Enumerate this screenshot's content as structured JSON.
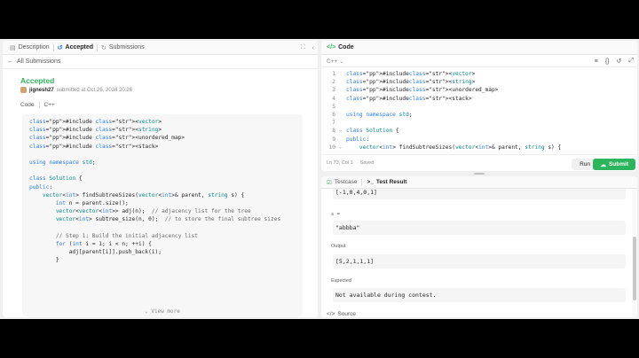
{
  "left_tabs": [
    {
      "label": "Description",
      "icon": "document-icon"
    },
    {
      "label": "Accepted",
      "icon": "history-icon"
    },
    {
      "label": "Submissions",
      "icon": "submissions-icon"
    }
  ],
  "back_link": "All Submissions",
  "submission": {
    "status": "Accepted",
    "user": "jignesh27",
    "submitted_text": "submitted at Oct 26, 2024 20:26",
    "code_tab": "Code",
    "lang": "C++"
  },
  "submission_code": [
    "#include <vector>",
    "#include <string>",
    "#include <unordered_map>",
    "#include <stack>",
    "",
    "using namespace std;",
    "",
    "class Solution {",
    "public:",
    "    vector<int> findSubtreeSizes(vector<int>& parent, string s) {",
    "        int n = parent.size();",
    "        vector<vector<int>> adj(n);  // adjacency list for the tree",
    "        vector<int> subtree_size(n, 0);  // to store the final subtree sizes",
    "",
    "        // Step 1: Build the initial adjacency list",
    "        for (int i = 1; i < n; ++i) {",
    "            adj[parent[i]].push_back(i);",
    "        }"
  ],
  "view_more": "View more",
  "code_panel": {
    "title": "Code",
    "lang": "C++",
    "lines": [
      {
        "n": "1",
        "fold": "",
        "text": "#include <vector>"
      },
      {
        "n": "2",
        "fold": "",
        "text": "#include <string>"
      },
      {
        "n": "3",
        "fold": "",
        "text": "#include <unordered_map>"
      },
      {
        "n": "4",
        "fold": "",
        "text": "#include <stack>"
      },
      {
        "n": "5",
        "fold": "",
        "text": ""
      },
      {
        "n": "6",
        "fold": "",
        "text": "using namespace std;"
      },
      {
        "n": "7",
        "fold": "",
        "text": ""
      },
      {
        "n": "8",
        "fold": "⌄",
        "text": "class Solution {"
      },
      {
        "n": "9",
        "fold": "",
        "text": "public:"
      },
      {
        "n": "10",
        "fold": "⌄",
        "text": "    vector<int> findSubtreeSizes(vector<int>& parent, string s) {"
      }
    ],
    "cursor": "Ln 73, Col 1",
    "saved": "Saved",
    "run": "Run",
    "submit": "Submit"
  },
  "bottom_tabs": [
    {
      "label": "Testcase",
      "icon": "checkbox-icon"
    },
    {
      "label": "Test Result",
      "icon": "terminal-icon"
    }
  ],
  "test_result": {
    "input_partial": "[-1,0,4,0,1]",
    "s_label": "s =",
    "s_value": "\"abbba\"",
    "output_label": "Output",
    "output_value": "[5,2,1,1,1]",
    "expected_label": "Expected",
    "expected_value": "Not available during contest."
  },
  "source_label": "Source",
  "colors": {
    "accent_green": "#2db55d",
    "accent_blue": "#2b7de9"
  }
}
